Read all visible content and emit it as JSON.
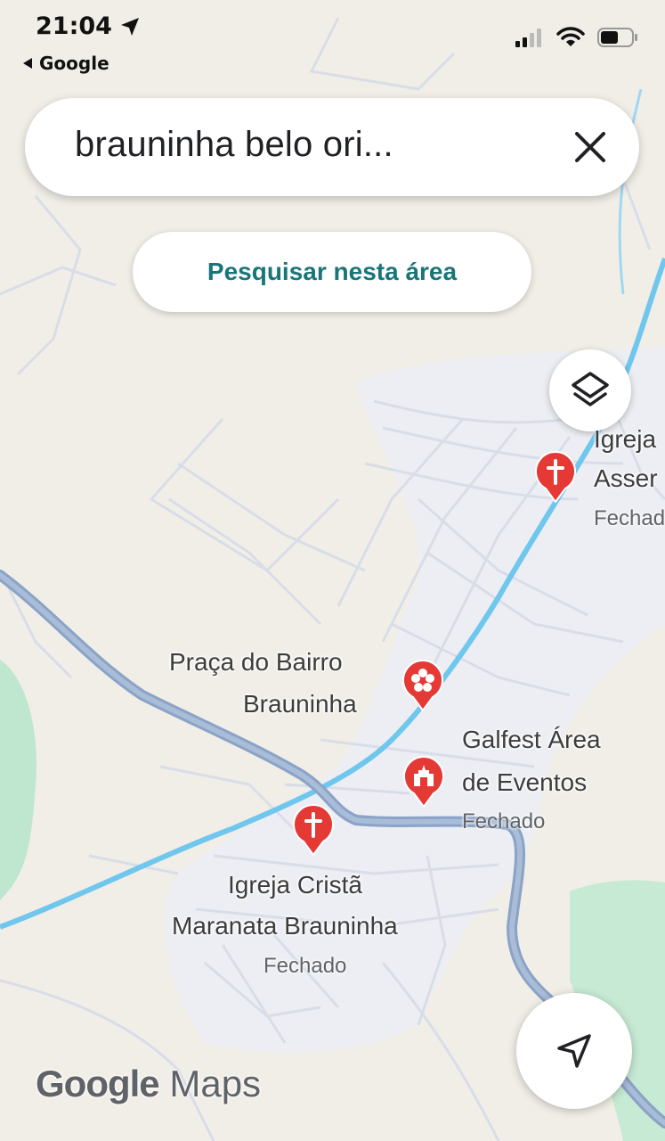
{
  "status_bar": {
    "time": "21:04",
    "back_label": "Google"
  },
  "search": {
    "query": "brauninha belo ori...",
    "search_area_label": "Pesquisar nesta área"
  },
  "places": [
    {
      "name_line1": "Igreja",
      "name_line2": "Asser",
      "status": "Fechado",
      "icon": "church-icon"
    },
    {
      "name_line1": "Praça do Bairro",
      "name_line2": "Brauninha",
      "status": "",
      "icon": "park-flower-icon"
    },
    {
      "name_line1": "Galfest Área",
      "name_line2": "de Eventos",
      "status": "Fechado",
      "icon": "event-venue-icon"
    },
    {
      "name_line1": "Igreja Cristã",
      "name_line2": "Maranata Brauninha",
      "status": "Fechado",
      "icon": "church-icon"
    }
  ],
  "branding": {
    "google": "Google",
    "maps": "Maps"
  },
  "colors": {
    "pin_red": "#e53935",
    "accent_teal": "#1a7579",
    "highway": "#8aa3c6",
    "river": "#6fc7ee",
    "park": "#bfe6cf"
  }
}
